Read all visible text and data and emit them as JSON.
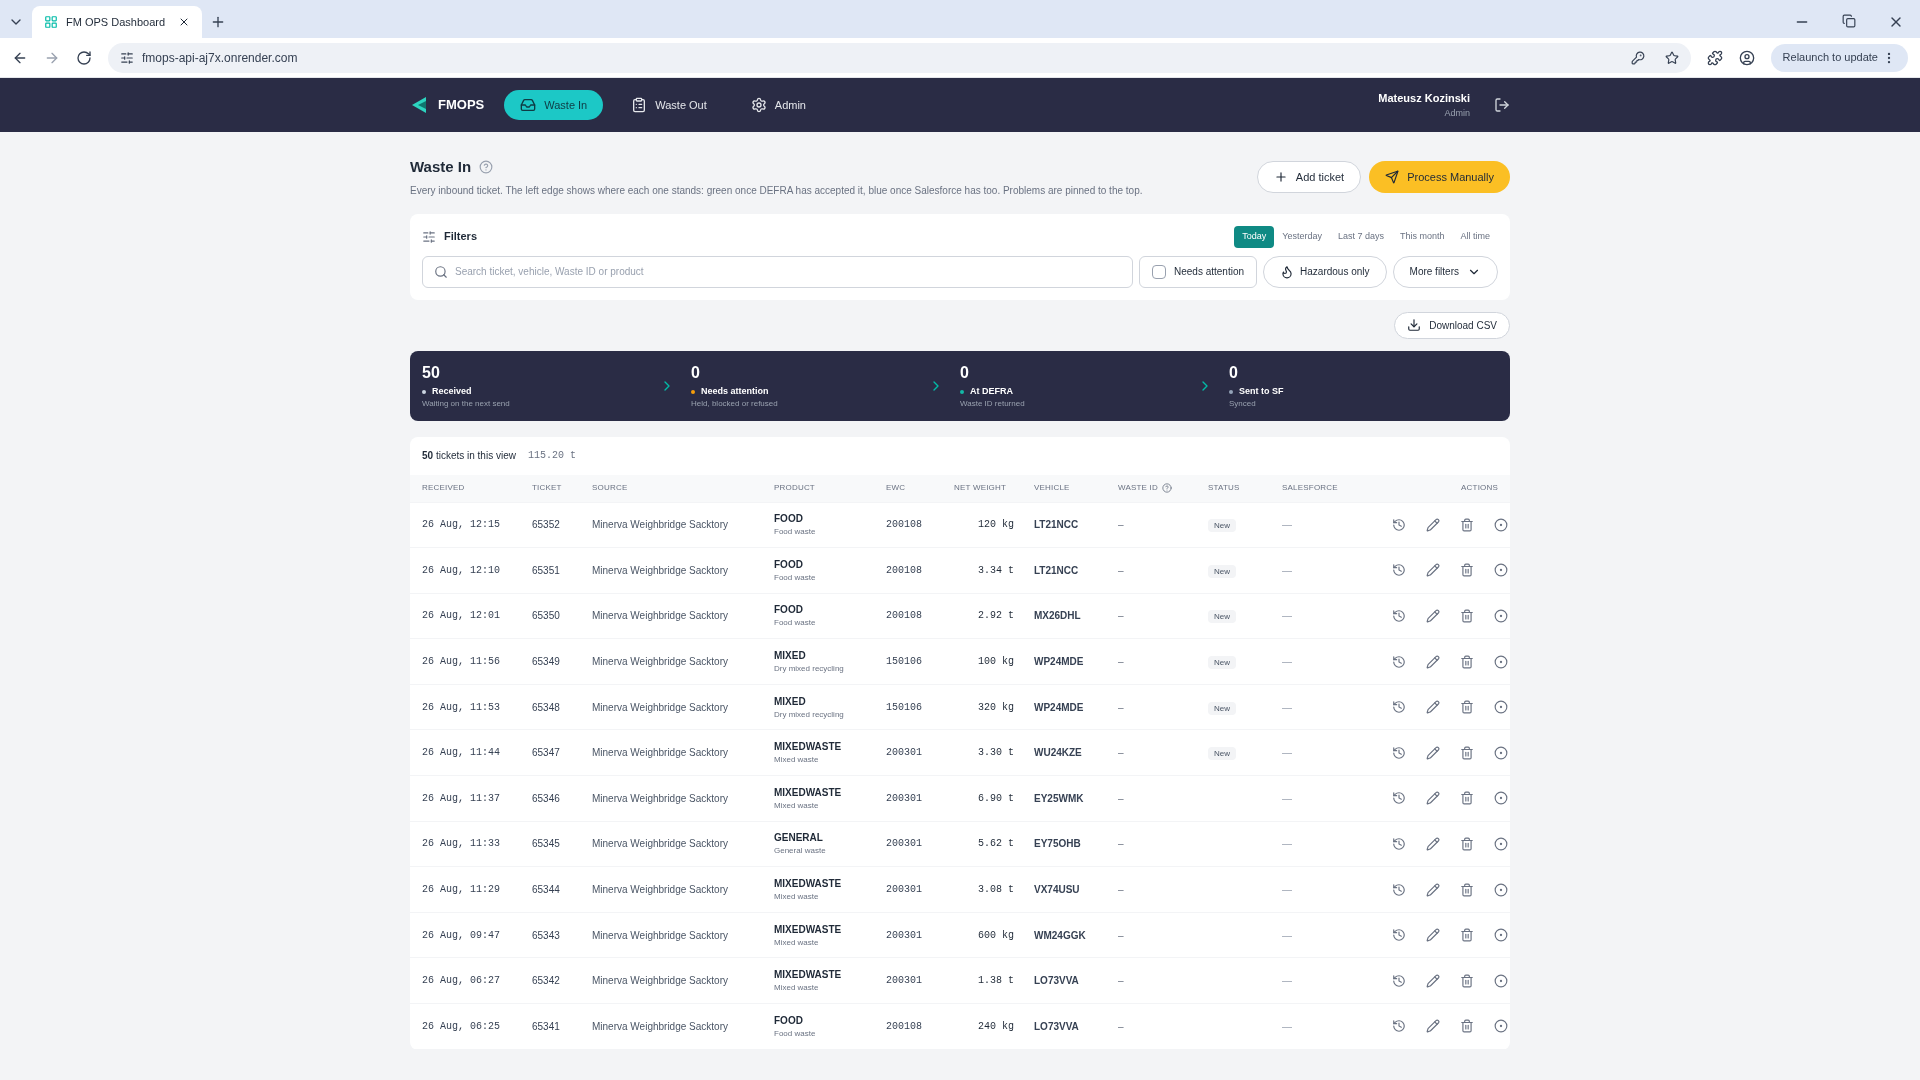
{
  "browser": {
    "tab_title": "FM OPS Dashboard",
    "url": "fmops-api-aj7x.onrender.com",
    "relaunch": "Relaunch to update"
  },
  "nav": {
    "logo": "FMOPS",
    "items": [
      {
        "label": "Waste In",
        "selected": true,
        "kind": "inbox"
      },
      {
        "label": "Waste Out",
        "selected": false,
        "kind": "clipboard"
      },
      {
        "label": "Admin",
        "selected": false,
        "kind": "gear"
      }
    ],
    "user": "Mateusz Kozinski",
    "role": "Admin"
  },
  "page": {
    "title": "Waste In",
    "description": "Every inbound ticket. The left edge shows where each one stands: green once DEFRA has accepted it, blue once Salesforce has too. Problems are pinned to the top.",
    "add_button": "Add ticket",
    "process_button": "Process Manually"
  },
  "filters": {
    "title": "Filters",
    "ranges": [
      {
        "label": "Today",
        "selected": true
      },
      {
        "label": "Yesterday",
        "selected": false
      },
      {
        "label": "Last 7 days",
        "selected": false
      },
      {
        "label": "This month",
        "selected": false
      },
      {
        "label": "All time",
        "selected": false
      }
    ],
    "search_placeholder": "Search ticket, vehicle, Waste ID or product",
    "needs_attention": {
      "label": "Needs attention",
      "checked": false
    },
    "hazardous": "Hazardous only",
    "more": "More filters"
  },
  "download": "Download CSV",
  "stages": [
    {
      "count": "50",
      "label": "Received",
      "sub": "Waiting on the next send",
      "color": "#cbd5e1"
    },
    {
      "count": "0",
      "label": "Needs attention",
      "sub": "Held, blocked or refused",
      "color": "#f59e0b"
    },
    {
      "count": "0",
      "label": "At DEFRA",
      "sub": "Waste ID returned",
      "color": "#14b8a6"
    },
    {
      "count": "0",
      "label": "Sent to SF",
      "sub": "Synced",
      "color": "#94a3b8"
    }
  ],
  "table": {
    "count": "50",
    "count_suffix": "tickets in this view",
    "total": "115.20 t",
    "columns": [
      "RECEIVED",
      "TICKET",
      "SOURCE",
      "PRODUCT",
      "EWC",
      "NET WEIGHT",
      "VEHICLE",
      "WASTE ID",
      "STATUS",
      "SALESFORCE",
      "ACTIONS"
    ],
    "rows": [
      {
        "received": "26 Aug, 12:15",
        "ticket": "65352",
        "source": "Minerva Weighbridge Sacktory",
        "product": "FOOD",
        "product_sub": "Food waste",
        "ewc": "200108",
        "weight": "120 kg",
        "vehicle": "LT21NCC",
        "waste_id": "–",
        "status": "New",
        "salesforce": "—"
      },
      {
        "received": "26 Aug, 12:10",
        "ticket": "65351",
        "source": "Minerva Weighbridge Sacktory",
        "product": "FOOD",
        "product_sub": "Food waste",
        "ewc": "200108",
        "weight": "3.34 t",
        "vehicle": "LT21NCC",
        "waste_id": "–",
        "status": "New",
        "salesforce": "—"
      },
      {
        "received": "26 Aug, 12:01",
        "ticket": "65350",
        "source": "Minerva Weighbridge Sacktory",
        "product": "FOOD",
        "product_sub": "Food waste",
        "ewc": "200108",
        "weight": "2.92 t",
        "vehicle": "MX26DHL",
        "waste_id": "–",
        "status": "New",
        "salesforce": "—"
      },
      {
        "received": "26 Aug, 11:56",
        "ticket": "65349",
        "source": "Minerva Weighbridge Sacktory",
        "product": "MIXED",
        "product_sub": "Dry mixed recycling",
        "ewc": "150106",
        "weight": "100 kg",
        "vehicle": "WP24MDE",
        "waste_id": "–",
        "status": "New",
        "salesforce": "—"
      },
      {
        "received": "26 Aug, 11:53",
        "ticket": "65348",
        "source": "Minerva Weighbridge Sacktory",
        "product": "MIXED",
        "product_sub": "Dry mixed recycling",
        "ewc": "150106",
        "weight": "320 kg",
        "vehicle": "WP24MDE",
        "waste_id": "–",
        "status": "New",
        "salesforce": "—"
      },
      {
        "received": "26 Aug, 11:44",
        "ticket": "65347",
        "source": "Minerva Weighbridge Sacktory",
        "product": "MIXEDWASTE",
        "product_sub": "Mixed waste",
        "ewc": "200301",
        "weight": "3.30 t",
        "vehicle": "WU24KZE",
        "waste_id": "–",
        "status": "New",
        "salesforce": "—"
      },
      {
        "received": "26 Aug, 11:37",
        "ticket": "65346",
        "source": "Minerva Weighbridge Sacktory",
        "product": "MIXEDWASTE",
        "product_sub": "Mixed waste",
        "ewc": "200301",
        "weight": "6.90 t",
        "vehicle": "EY25WMK",
        "waste_id": "–",
        "salesforce": "—"
      },
      {
        "received": "26 Aug, 11:33",
        "ticket": "65345",
        "source": "Minerva Weighbridge Sacktory",
        "product": "GENERAL",
        "product_sub": "General waste",
        "ewc": "200301",
        "weight": "5.62 t",
        "vehicle": "EY75OHB",
        "waste_id": "–",
        "salesforce": "—"
      },
      {
        "received": "26 Aug, 11:29",
        "ticket": "65344",
        "source": "Minerva Weighbridge Sacktory",
        "product": "MIXEDWASTE",
        "product_sub": "Mixed waste",
        "ewc": "200301",
        "weight": "3.08 t",
        "vehicle": "VX74USU",
        "waste_id": "–",
        "salesforce": "—"
      },
      {
        "received": "26 Aug, 09:47",
        "ticket": "65343",
        "source": "Minerva Weighbridge Sacktory",
        "product": "MIXEDWASTE",
        "product_sub": "Mixed waste",
        "ewc": "200301",
        "weight": "600 kg",
        "vehicle": "WM24GGK",
        "waste_id": "–",
        "salesforce": "—"
      },
      {
        "received": "26 Aug, 06:27",
        "ticket": "65342",
        "source": "Minerva Weighbridge Sacktory",
        "product": "MIXEDWASTE",
        "product_sub": "Mixed waste",
        "ewc": "200301",
        "weight": "1.38 t",
        "vehicle": "LO73VVA",
        "waste_id": "–",
        "salesforce": "—"
      },
      {
        "received": "26 Aug, 06:25",
        "ticket": "65341",
        "source": "Minerva Weighbridge Sacktory",
        "product": "FOOD",
        "product_sub": "Food waste",
        "ewc": "200108",
        "weight": "240 kg",
        "vehicle": "LO73VVA",
        "waste_id": "–",
        "salesforce": "—"
      }
    ]
  }
}
